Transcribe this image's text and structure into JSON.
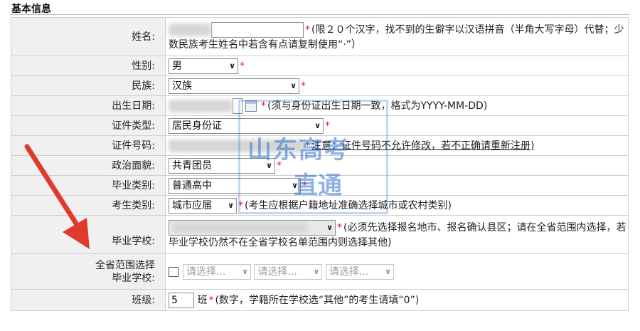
{
  "section_title": "基本信息",
  "rows": {
    "name": {
      "label": "姓名:",
      "note": "(限２０个汉字，找不到的生僻字以汉语拼音（半角大写字母）代替；少数民族考生姓名中若含有点请复制使用“·”）"
    },
    "gender": {
      "label": "性别:",
      "value": "男"
    },
    "ethnicity": {
      "label": "民族:",
      "value": "汉族"
    },
    "birthdate": {
      "label": "出生日期:",
      "note": "(须与身份证出生日期一致，格式为YYYY-MM-DD)"
    },
    "id_type": {
      "label": "证件类型:",
      "value": "居民身份证"
    },
    "id_number": {
      "label": "证件号码:",
      "note": "注意：证件号码不允许修改，若不正确请重新注册)"
    },
    "political": {
      "label": "政治面貌:",
      "value": "共青团员"
    },
    "grad_type": {
      "label": "毕业类别:",
      "value": "普通高中"
    },
    "candidate_type": {
      "label": "考生类别:",
      "value": "城市应届",
      "note": "(考生应根据户籍地址准确选择城市或农村类别)"
    },
    "school": {
      "label": "毕业学校:",
      "note": "(必须先选择报名地市、报名确认县区；请在全省范围内选择，若毕业学校仍然不在全省学校名单范围内则选择其他)"
    },
    "province_school": {
      "label1": "全省范围选择",
      "label2": "毕业学校:",
      "placeholder": "请选择..."
    },
    "class": {
      "label": "班级:",
      "value": "5",
      "unit": "班",
      "note": "(数字，学籍所在学校选“其他”的考生请填“0”)"
    }
  },
  "watermark": {
    "line1": "山东高考",
    "line2": "直通"
  },
  "colors": {
    "required": "#e02020",
    "label_bg": "#f0f0f0",
    "arrow": "#e0392f",
    "watermark": "#1f67c8"
  }
}
